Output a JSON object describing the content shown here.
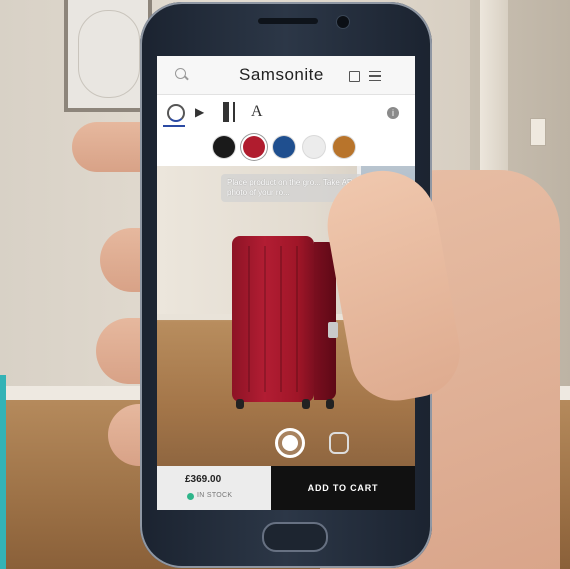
{
  "header": {
    "brand": "Samsonite",
    "icons": {
      "search": "search-icon",
      "bag": "bag-icon",
      "menu": "hamburger-menu-icon"
    }
  },
  "toolbar": {
    "tools": [
      {
        "name": "ar-view",
        "icon": "ar-view-icon",
        "active": true
      },
      {
        "name": "play",
        "icon": "play-icon",
        "glyph": "▶"
      },
      {
        "name": "size",
        "icon": "size-icon"
      },
      {
        "name": "text",
        "icon": "text-icon",
        "glyph": "A"
      }
    ],
    "info_glyph": "i"
  },
  "swatches": {
    "colors": [
      "#1a1a1a",
      "#b01c2e",
      "#1f4f8f",
      "#ececec",
      "#b8742b"
    ],
    "selected_index": 1
  },
  "ar": {
    "hint": "Place product on the gro... Take AR photo of your ro...",
    "accent": "#2b4aa3"
  },
  "product": {
    "price": "£369.00",
    "stock": "IN STOCK",
    "stock_color": "#2fb58a",
    "add_to_cart": "ADD TO CART"
  }
}
